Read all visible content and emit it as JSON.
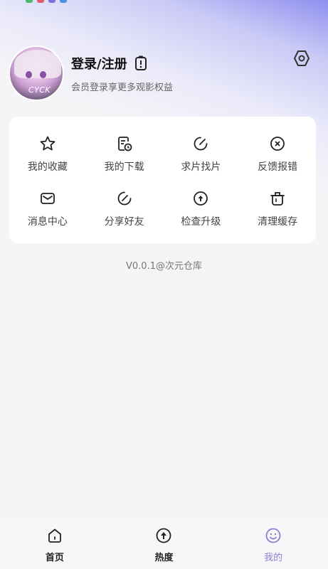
{
  "profile": {
    "title": "登录/注册",
    "subtitle": "会员登录享更多观影权益",
    "avatar_text": "CYCK"
  },
  "colors": {
    "accent": "#8a7fd6",
    "header_gradient_top": "#8f8ff0",
    "background": "#f5f5f7"
  },
  "menu": {
    "items": [
      {
        "label": "我的收藏",
        "icon": "star-icon"
      },
      {
        "label": "我的下载",
        "icon": "download-doc-icon"
      },
      {
        "label": "求片找片",
        "icon": "edit-circle-icon"
      },
      {
        "label": "反馈报错",
        "icon": "close-circle-icon"
      },
      {
        "label": "消息中心",
        "icon": "mail-icon"
      },
      {
        "label": "分享好友",
        "icon": "share-edit-icon"
      },
      {
        "label": "检查升级",
        "icon": "upgrade-icon"
      },
      {
        "label": "清理缓存",
        "icon": "trash-icon"
      }
    ]
  },
  "version": "V0.0.1@次元仓库",
  "tabs": [
    {
      "label": "首页",
      "icon": "home-icon",
      "active": false
    },
    {
      "label": "热度",
      "icon": "trending-icon",
      "active": false
    },
    {
      "label": "我的",
      "icon": "smile-icon",
      "active": true
    }
  ]
}
